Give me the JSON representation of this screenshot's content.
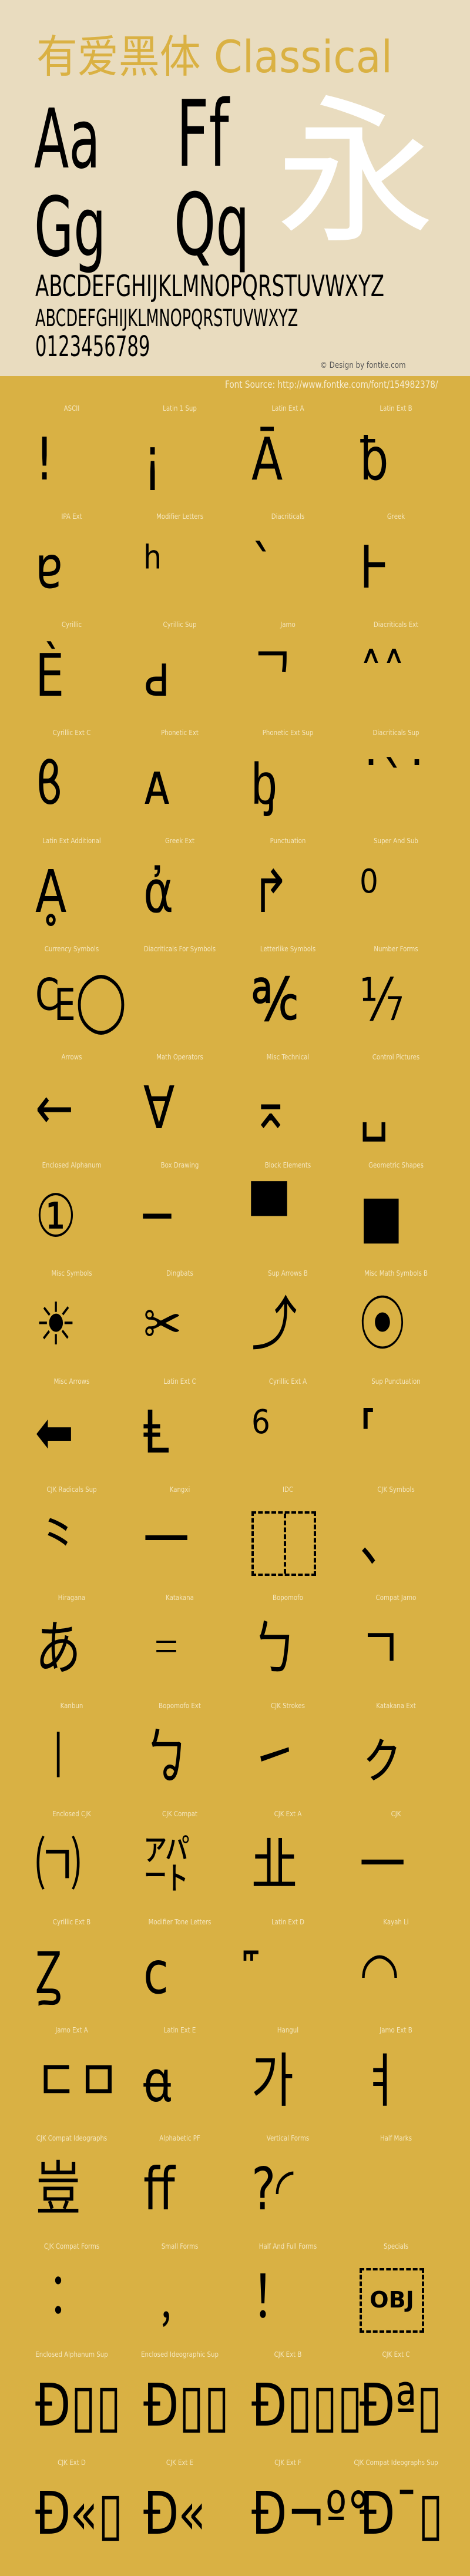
{
  "header": {
    "title": "有爱黑体 Classical",
    "specimen_pairs": [
      "Aa",
      "Ff",
      "Gg",
      "Qq"
    ],
    "hero_glyph": "永",
    "uppercase_line": "ABCDEFGHIJKLMNOPQRSTUVWXYZ",
    "small_caps_line": "ABCDEFGHIJKLMNOPQRSTUVWXYZ",
    "digits_line": "0123456789",
    "credit": "© Design by fontke.com"
  },
  "font_source": "Font Source: http://www.fontke.com/font/154982378/",
  "colors": {
    "header_bg": "#e9dcbf",
    "body_bg": "#d9b144",
    "title": "#dab143",
    "label": "#f5e6bd",
    "glyph": "#000000",
    "hero": "#ffffff"
  },
  "blocks": [
    {
      "label": "ASCII",
      "glyph": "!"
    },
    {
      "label": "Latin 1 Sup",
      "glyph": "¡"
    },
    {
      "label": "Latin Ext A",
      "glyph": "Ā"
    },
    {
      "label": "Latin Ext B",
      "glyph": "ƀ"
    },
    {
      "label": "IPA Ext",
      "glyph": "ɐ"
    },
    {
      "label": "Modifier Letters",
      "glyph": "ʰ"
    },
    {
      "label": "Diacriticals",
      "glyph": "ˋ"
    },
    {
      "label": "Greek",
      "glyph": "Ͱ"
    },
    {
      "label": "Cyrillic",
      "glyph": "Ѐ"
    },
    {
      "label": "Cyrillic Sup",
      "glyph": "ԁ"
    },
    {
      "label": "Jamo",
      "glyph": "ᄀ"
    },
    {
      "label": "Diacriticals Ext",
      "glyph": "˄˄"
    },
    {
      "label": "Cyrillic Ext C",
      "glyph": "ϐ"
    },
    {
      "label": "Phonetic Ext",
      "glyph": "ᴀ"
    },
    {
      "label": "Phonetic Ext Sup",
      "glyph": "ᶀ"
    },
    {
      "label": "Diacriticals Sup",
      "glyph": "˙ˋ˙"
    },
    {
      "label": "Latin Ext Additional",
      "glyph": "Ḁ"
    },
    {
      "label": "Greek Ext",
      "glyph": "ἀ"
    },
    {
      "label": "Punctuation",
      "glyph": "↱"
    },
    {
      "label": "Super And Sub",
      "glyph": "⁰"
    },
    {
      "label": "Currency Symbols",
      "glyph": "₠◯"
    },
    {
      "label": "Diacriticals For Symbols",
      "glyph": ""
    },
    {
      "label": "Letterlike Symbols",
      "glyph": "℀"
    },
    {
      "label": "Number Forms",
      "glyph": "⅐"
    },
    {
      "label": "Arrows",
      "glyph": "←"
    },
    {
      "label": "Math Operators",
      "glyph": "∀"
    },
    {
      "label": "Misc Technical",
      "glyph": "⌅"
    },
    {
      "label": "Control Pictures",
      "glyph": "␣"
    },
    {
      "label": "Enclosed Alphanum",
      "glyph": "①"
    },
    {
      "label": "Box Drawing",
      "glyph": "─"
    },
    {
      "label": "Block Elements",
      "glyph": "▀"
    },
    {
      "label": "Geometric Shapes",
      "glyph": "■"
    },
    {
      "label": "Misc Symbols",
      "glyph": "☀"
    },
    {
      "label": "Dingbats",
      "glyph": "✂"
    },
    {
      "label": "Sup Arrows B",
      "glyph": "⤴"
    },
    {
      "label": "Misc Math Symbols B",
      "glyph": "⦿"
    },
    {
      "label": "Misc Arrows",
      "glyph": "⬅"
    },
    {
      "label": "Latin Ext C",
      "glyph": "Ⱡ"
    },
    {
      "label": "Cyrillic Ext A",
      "glyph": "⁶"
    },
    {
      "label": "Sup Punctuation",
      "glyph": "⸢"
    },
    {
      "label": "CJK Radicals Sup",
      "glyph": "⺀"
    },
    {
      "label": "Kangxi",
      "glyph": "⼀"
    },
    {
      "label": "IDC",
      "glyph": "",
      "box": "idc"
    },
    {
      "label": "CJK Symbols",
      "glyph": "、"
    },
    {
      "label": "Hiragana",
      "glyph": "あ"
    },
    {
      "label": "Katakana",
      "glyph": "゠"
    },
    {
      "label": "Bopomofo",
      "glyph": "ㄅ"
    },
    {
      "label": "Compat Jamo",
      "glyph": "ㄱ"
    },
    {
      "label": "Kanbun",
      "glyph": "㆐"
    },
    {
      "label": "Bopomofo Ext",
      "glyph": "ㆠ"
    },
    {
      "label": "CJK Strokes",
      "glyph": "㇀"
    },
    {
      "label": "Katakana Ext",
      "glyph": "ㇰ"
    },
    {
      "label": "Enclosed CJK",
      "glyph": "㈀"
    },
    {
      "label": "CJK Compat",
      "glyph": "㌀"
    },
    {
      "label": "CJK Ext A",
      "glyph": "㐀"
    },
    {
      "label": "CJK",
      "glyph": "一"
    },
    {
      "label": "Cyrillic Ext B",
      "glyph": "Ꙁ"
    },
    {
      "label": "Modifier Tone Letters",
      "glyph": "ᴄ"
    },
    {
      "label": "Latin Ext D",
      "glyph": "꜠"
    },
    {
      "label": "Kayah Li",
      "glyph": "◠"
    },
    {
      "label": "Jamo Ext A",
      "glyph": "ㄷㅁ"
    },
    {
      "label": "Latin Ext E",
      "glyph": "ꬰ"
    },
    {
      "label": "Hangul",
      "glyph": "가"
    },
    {
      "label": "Jamo Ext B",
      "glyph": "ㅕ"
    },
    {
      "label": "CJK Compat Ideographs",
      "glyph": "豈"
    },
    {
      "label": "Alphabetic PF",
      "glyph": "ﬀ"
    },
    {
      "label": "Vertical Forms",
      "glyph": " ?◜"
    },
    {
      "label": "Half Marks",
      "glyph": ""
    },
    {
      "label": "CJK Compat Forms",
      "glyph": "︰"
    },
    {
      "label": "Small Forms",
      "glyph": "﹐"
    },
    {
      "label": "Half And Full Forms",
      "glyph": "！"
    },
    {
      "label": "Specials",
      "glyph": "",
      "box": "obj",
      "box_text": "OBJ"
    },
    {
      "label": "Enclosed Alphanum Sup",
      "glyph": "Đ▯▯"
    },
    {
      "label": "Enclosed Ideographic Sup",
      "glyph": "Đ▯▯"
    },
    {
      "label": "CJK Ext B",
      "glyph": "Đ▯▯▯"
    },
    {
      "label": "CJK Ext C",
      "glyph": "Đª▯"
    },
    {
      "label": "CJK Ext D",
      "glyph": "Đ«▯"
    },
    {
      "label": "CJK Ext E",
      "glyph": "Đ«"
    },
    {
      "label": "CJK Ext F",
      "glyph": "Đ¬º°"
    },
    {
      "label": "CJK Compat Ideographs Sup",
      "glyph": "Đ¯▯"
    }
  ]
}
